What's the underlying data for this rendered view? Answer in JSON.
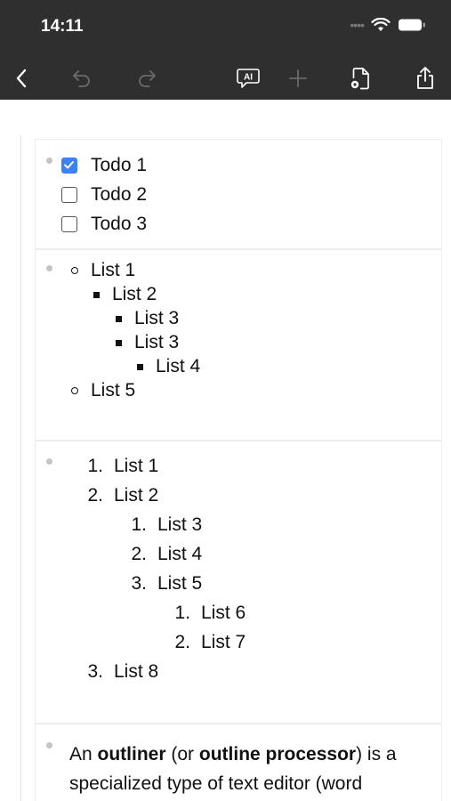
{
  "status": {
    "time": "14:11"
  },
  "toolbar": {
    "back": "back-icon",
    "undo": "undo-icon",
    "redo": "redo-icon",
    "ai": "AI",
    "add": "plus-icon",
    "doc_settings": "doc-settings-icon",
    "share": "share-icon"
  },
  "todos": [
    {
      "label": "Todo 1",
      "checked": true
    },
    {
      "label": "Todo 2",
      "checked": false
    },
    {
      "label": "Todo 3",
      "checked": false
    }
  ],
  "bullets": [
    {
      "label": "List 1"
    },
    {
      "label": "List 2"
    },
    {
      "label": "List 3"
    },
    {
      "label": "List 3"
    },
    {
      "label": "List 4"
    },
    {
      "label": "List 5"
    }
  ],
  "numbered": [
    {
      "num": "1.",
      "label": "List 1"
    },
    {
      "num": "2.",
      "label": "List 2"
    },
    {
      "num": "1.",
      "label": "List 3"
    },
    {
      "num": "2.",
      "label": "List 4"
    },
    {
      "num": "3.",
      "label": "List 5"
    },
    {
      "num": "1.",
      "label": "List 6"
    },
    {
      "num": "2.",
      "label": "List 7"
    },
    {
      "num": "3.",
      "label": "List 8"
    }
  ],
  "paragraph": {
    "t1": "An ",
    "b1": "outliner",
    "t2": " (or ",
    "b2": "outline processor",
    "t3": ") is a specialized type of text editor (word processor) used to create and edit"
  }
}
